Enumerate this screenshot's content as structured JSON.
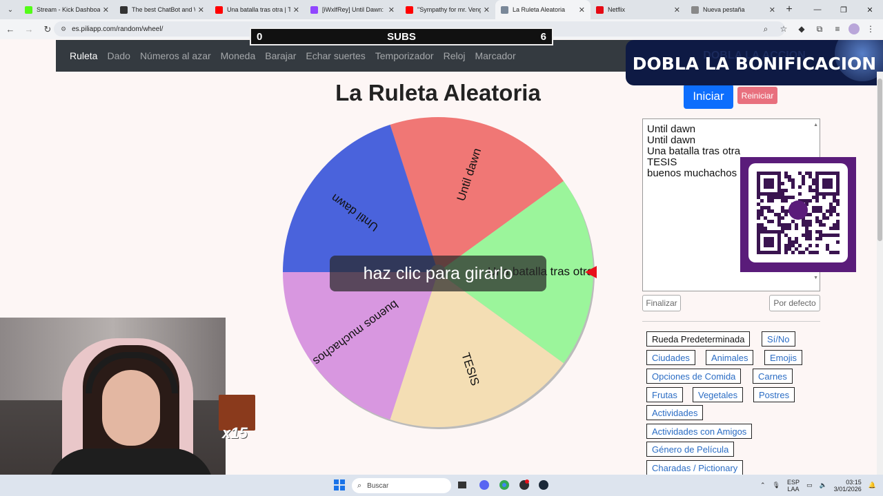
{
  "browser": {
    "tabs": [
      {
        "label": "Stream - Kick Dashboard",
        "favicon_color": "#53fc18"
      },
      {
        "label": "The best ChatBot and Wi",
        "favicon_color": "#333333"
      },
      {
        "label": "Una batalla tras otra | Trái",
        "favicon_color": "#ff0000"
      },
      {
        "label": "[iWxlfRey] Until Dawn: No",
        "favicon_color": "#9146ff"
      },
      {
        "label": "\"Sympathy for mr. Venge",
        "favicon_color": "#ff0000"
      },
      {
        "label": "La Ruleta Aleatoria",
        "favicon_color": "#7a8899"
      },
      {
        "label": "Netflix",
        "favicon_color": "#e50914"
      },
      {
        "label": "Nueva pestaña",
        "favicon_color": "#888888"
      }
    ],
    "active_tab_index": 5,
    "url": "es.piliapp.com/random/wheel/"
  },
  "site_nav": {
    "items": [
      "Ruleta",
      "Dado",
      "Números al azar",
      "Moneda",
      "Barajar",
      "Echar suertes",
      "Temporizador",
      "Reloj",
      "Marcador"
    ],
    "active": "Ruleta"
  },
  "page": {
    "title": "La Ruleta Aleatoria"
  },
  "wheel": {
    "overlay_text": "haz clic para girarlo",
    "pointer_color": "#e8101a",
    "segments": [
      {
        "label": "Until dawn",
        "color": "#f07775"
      },
      {
        "label": "Una batalla tras otra",
        "color": "#9bf59b"
      },
      {
        "label": "TESIS",
        "color": "#f4deb4"
      },
      {
        "label": "buenos muchachos",
        "color": "#d897e0"
      },
      {
        "label": "Until dawn",
        "color": "#4a63dc"
      }
    ]
  },
  "controls": {
    "start_label": "Iniciar",
    "reset_label": "Reiniciar",
    "entries": [
      "Until dawn",
      "Until dawn",
      "Una batalla tras otra",
      "TESIS",
      "buenos muchachos"
    ],
    "finish_label": "Finalizar",
    "default_label": "Por defecto"
  },
  "presets": [
    {
      "label": "Rueda Predeterminada",
      "selected": true
    },
    {
      "label": "Sí/No"
    },
    {
      "label": "Ciudades"
    },
    {
      "label": "Animales"
    },
    {
      "label": "Emojis"
    },
    {
      "label": "Opciones de Comida"
    },
    {
      "label": "Carnes"
    },
    {
      "label": "Frutas"
    },
    {
      "label": "Vegetales"
    },
    {
      "label": "Postres"
    },
    {
      "label": "Actividades"
    },
    {
      "label": "Actividades con Amigos"
    },
    {
      "label": "Género de Película"
    },
    {
      "label": "Charadas / Pictionary"
    }
  ],
  "overlays": {
    "subs_left": "0",
    "subs_label": "SUBS",
    "subs_right": "6",
    "bonus_ghost": "DOBLA LA ACCION",
    "bonus_main": "DOBLA LA BONIFICACION",
    "emote_count": "x15"
  },
  "taskbar": {
    "search_placeholder": "Buscar",
    "lang_line1": "ESP",
    "lang_line2": "LAA",
    "time": "03:15",
    "date": "3/01/2026"
  }
}
